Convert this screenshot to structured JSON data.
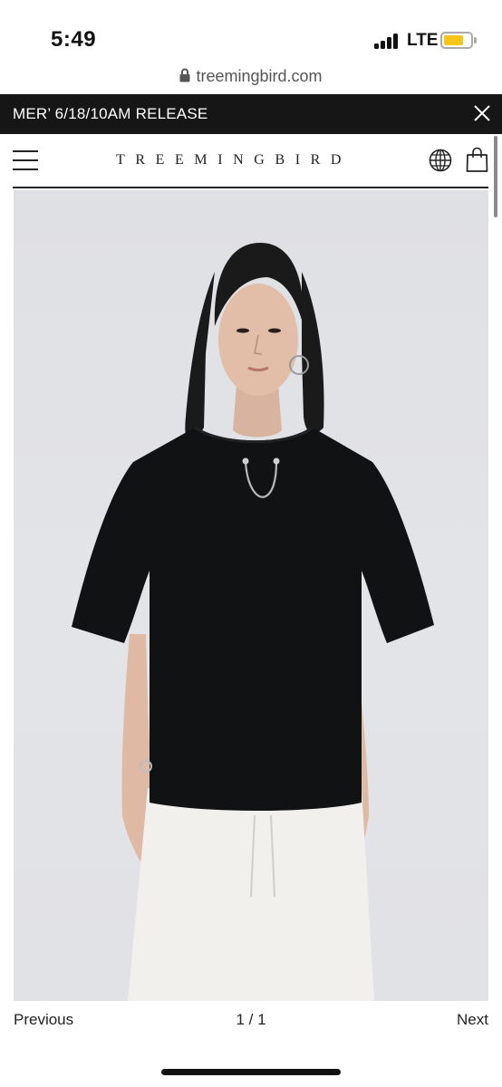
{
  "status_bar": {
    "time": "5:49",
    "network": "LTE",
    "battery_level": 0.75,
    "battery_color": "#f5c518"
  },
  "browser": {
    "url": "treemingbird.com"
  },
  "announcement": {
    "text": "MER’ 6/18/10AM RELEASE",
    "background": "#161616"
  },
  "header": {
    "brand": "TREEMINGBIRD",
    "icons": [
      "menu-icon",
      "globe-icon",
      "shopping-bag-icon"
    ]
  },
  "product": {
    "image": "product-photo"
  },
  "pager": {
    "previous": "Previous",
    "count": "1 / 1",
    "next": "Next"
  }
}
